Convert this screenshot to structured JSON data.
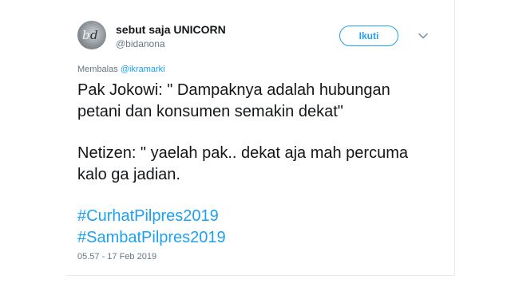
{
  "author": {
    "name": "sebut saja UNICORN",
    "handle": "@bidanona",
    "avatar_icon": "avatar-logo-icon"
  },
  "follow_button": {
    "label": "Ikuti"
  },
  "menu": {
    "icon": "chevron-down-icon"
  },
  "reply_context": {
    "prefix": "Membalas",
    "mention": "@ikramarki"
  },
  "tweet": {
    "lines": [
      "Pak Jokowi: \" Dampaknya adalah hubungan",
      "petani dan konsumen semakin dekat\"",
      "Netizen: \" yaelah pak.. dekat aja mah percuma",
      "kalo ga jadian."
    ],
    "hashtags": [
      "#CurhatPilpres2019",
      "#SambatPilpres2019"
    ],
    "timestamp": "05.57 - 17 Feb 2019"
  },
  "colors": {
    "link": "#1da1f2",
    "text": "#14171a",
    "muted": "#657786"
  }
}
